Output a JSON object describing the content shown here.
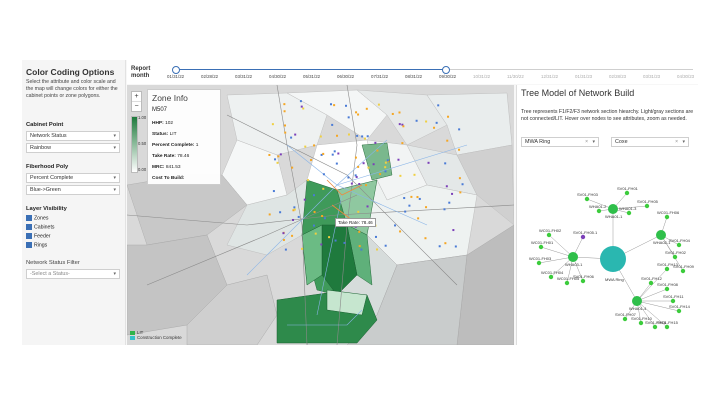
{
  "left_panel": {
    "title": "Color Coding Options",
    "description": "Select the attribute and color scale and the map will change colors for either the cabinet points or zone polygons.",
    "cabinet_point": {
      "heading": "Cabinet Point",
      "attribute": "Network Status",
      "scale": "Rainbow"
    },
    "fiberhood_poly": {
      "heading": "Fiberhood Poly",
      "attribute": "Percent Complete",
      "scale": "Blue->Green"
    },
    "layer_visibility": {
      "heading": "Layer Visibility",
      "layers": [
        "Zones",
        "Cabinets",
        "Feeder",
        "Rings"
      ]
    },
    "network_status_filter": {
      "heading": "Network Status Filter",
      "placeholder": "-Select a Status-"
    }
  },
  "timeline": {
    "label_line1": "Report",
    "label_line2": "month",
    "dates": [
      "01/31/22",
      "02/28/22",
      "03/31/22",
      "04/30/22",
      "05/31/22",
      "06/30/22",
      "07/31/22",
      "08/31/22",
      "09/30/22",
      "10/31/22",
      "11/30/22",
      "12/31/22",
      "01/31/23",
      "02/28/23",
      "03/31/23",
      "04/30/23"
    ],
    "selected": "09/30/22"
  },
  "map": {
    "zoom_in": "+",
    "zoom_out": "−",
    "legend_max": "1.00",
    "legend_mid": "0.50",
    "legend_min": "0.00",
    "zone_info": {
      "title": "Zone Info",
      "zone_id": "M507",
      "hhp_label": "HHP:",
      "hhp": "102",
      "status_label": "Status:",
      "status": "LIT",
      "percent_label": "Percent Complete:",
      "percent": "1",
      "take_rate_label": "Take Rate:",
      "take_rate": "78.46",
      "mrc_label": "MRC:",
      "mrc": "841.53",
      "cost_label": "Cost To Build:",
      "cost": ""
    },
    "tooltip": "Take Rate: 78.46",
    "bottom_legend": [
      {
        "label": "LIT",
        "color": "#2fb34a"
      },
      {
        "label": "Construction Complete",
        "color": "#35c2c9"
      }
    ]
  },
  "right_panel": {
    "title": "Tree Model of Network Build",
    "description": "Tree represents F1/F2/F3 network section hiearchy. Light/gray sections are not connected/LIT. Hover over nodes to see attributes, zoom as needed.",
    "ring_select": "MWA Ring",
    "second_select": "Coxe",
    "node_labels": {
      "ring": "MWA Ring",
      "hubs": [
        "WHA01-1",
        "WHA03-1",
        "WHA02-1",
        "WHA01-4"
      ],
      "leaves": [
        "SV01-FH03",
        "SV01-FH01",
        "WHA01-2",
        "WHA01-3",
        "SV01-FH05",
        "WC01-FH02",
        "WC01-FH01",
        "SV01-FH05.1",
        "WC01-FH03",
        "WC01-FH04",
        "WC01-FH05",
        "SV01-FH06",
        "WC01-FH06",
        "SV01-FH04",
        "SV01-FH02",
        "SV01-FH09",
        "SV01-FH13",
        "SV01-FH12",
        "SV01-FH08",
        "SV01-FH11",
        "SV01-FH14",
        "SV01-FH10",
        "SV01-FH07",
        "SV01-FH16",
        "SV01-FH15"
      ]
    },
    "colors": {
      "ring": "#2ab7b0",
      "hub": "#2fbf4a",
      "leaf": "#3ccc3c",
      "purple": "#7b3fb8"
    }
  }
}
